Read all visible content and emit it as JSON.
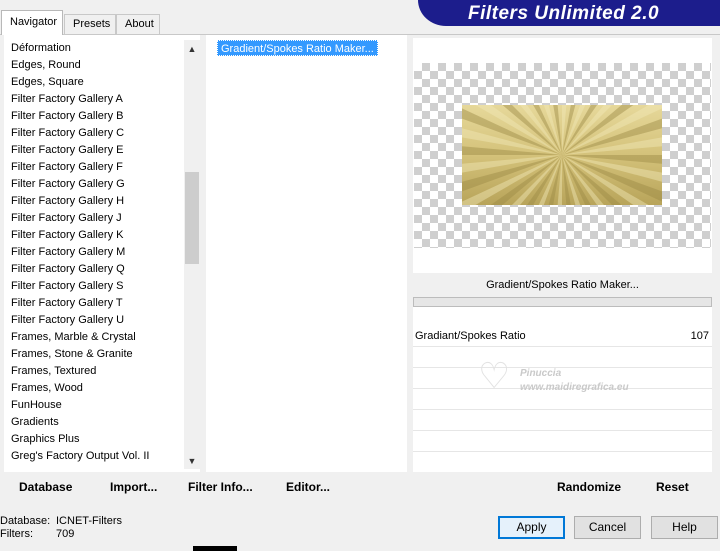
{
  "title": "Filters Unlimited 2.0",
  "tabs": [
    "Navigator",
    "Presets",
    "About"
  ],
  "categories": [
    "Déformation",
    "Edges, Round",
    "Edges, Square",
    "Filter Factory Gallery A",
    "Filter Factory Gallery B",
    "Filter Factory Gallery C",
    "Filter Factory Gallery E",
    "Filter Factory Gallery F",
    "Filter Factory Gallery G",
    "Filter Factory Gallery H",
    "Filter Factory Gallery J",
    "Filter Factory Gallery K",
    "Filter Factory Gallery M",
    "Filter Factory Gallery Q",
    "Filter Factory Gallery S",
    "Filter Factory Gallery T",
    "Filter Factory Gallery U",
    "Frames, Marble & Crystal",
    "Frames, Stone & Granite",
    "Frames, Textured",
    "Frames, Wood",
    "FunHouse",
    "Gradients",
    "Graphics Plus",
    "Greg's Factory Output Vol. II"
  ],
  "filters": [
    "Gradient/Spokes Ratio Maker..."
  ],
  "selected_filter_name": "Gradient/Spokes Ratio Maker...",
  "params": [
    {
      "label": "Gradiant/Spokes Ratio",
      "value": "107"
    }
  ],
  "watermark": {
    "line1": "Pinuccia",
    "line2": "www.maidiregrafica.eu"
  },
  "left_buttons": [
    "Database",
    "Import...",
    "Filter Info...",
    "Editor..."
  ],
  "right_buttons": [
    "Randomize",
    "Reset"
  ],
  "info": {
    "database_label": "Database:",
    "database_value": "ICNET-Filters",
    "filters_label": "Filters:",
    "filters_value": "709"
  },
  "dialog_buttons": {
    "apply": "Apply",
    "cancel": "Cancel",
    "help": "Help"
  },
  "colors": {
    "title_bg": "#1c1d8c",
    "selection": "#3399ff",
    "spoke_gold": "#d4c27a"
  }
}
